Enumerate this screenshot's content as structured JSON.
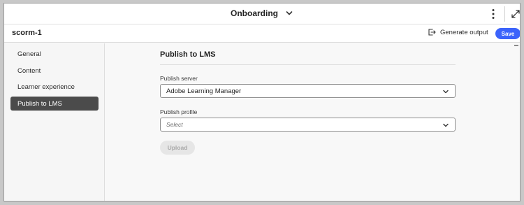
{
  "header": {
    "title": "Onboarding",
    "title_dropdown_icon": "chevron-down-icon",
    "menu_icon": "more-vertical-icon",
    "expand_icon": "expand-icon"
  },
  "toolbar": {
    "document_name": "scorm-1",
    "generate_output_label": "Generate output",
    "generate_output_icon": "export-icon",
    "save_label": "Save"
  },
  "sidebar": {
    "items": [
      {
        "label": "General",
        "active": false
      },
      {
        "label": "Content",
        "active": false
      },
      {
        "label": "Learner experience",
        "active": false
      },
      {
        "label": "Publish to LMS",
        "active": true
      }
    ]
  },
  "main": {
    "section_title": "Publish to LMS",
    "publish_server": {
      "label": "Publish server",
      "value": "Adobe Learning Manager"
    },
    "publish_profile": {
      "label": "Publish profile",
      "placeholder": "Select"
    },
    "upload_label": "Upload"
  },
  "colors": {
    "accent": "#3b63fb",
    "active_nav_bg": "#4b4b4b",
    "disabled_button_bg": "#e6e6e6"
  }
}
